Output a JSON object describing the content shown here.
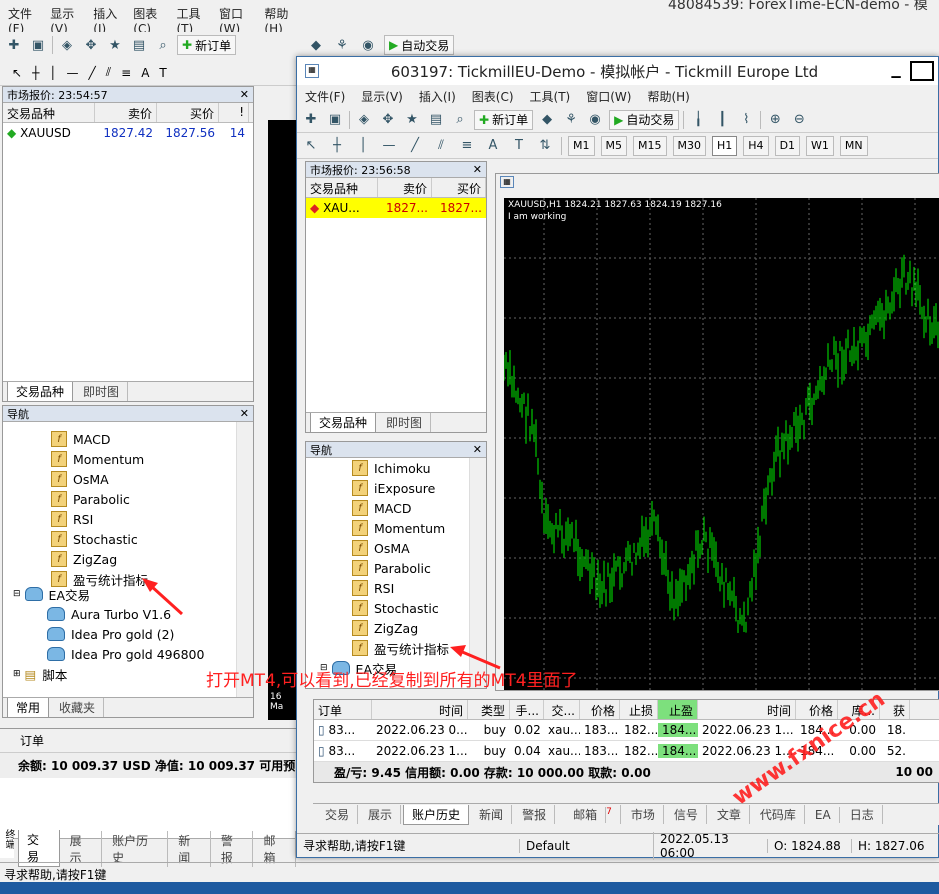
{
  "bg": {
    "title_fragment": "48084539: ForexTime-ECN-demo - 模",
    "menu": [
      "文件(F)",
      "显示(V)",
      "插入(I)",
      "图表(C)",
      "工具(T)",
      "窗口(W)",
      "帮助(H)"
    ],
    "new_order": "新订单",
    "auto_trade": "自动交易",
    "market_watch": {
      "title": "市场报价: 23:54:57",
      "headers": [
        "交易品种",
        "卖价",
        "买价",
        "!"
      ],
      "row": {
        "symbol": "XAUUSD",
        "bid": "1827.42",
        "ask": "1827.56",
        "spread": "14"
      },
      "tabs": [
        "交易品种",
        "即时图"
      ]
    },
    "navigator": {
      "title": "导航",
      "items": [
        "MACD",
        "Momentum",
        "OsMA",
        "Parabolic",
        "RSI",
        "Stochastic",
        "ZigZag",
        "盈亏统计指标"
      ],
      "ea_folder": "EA交易",
      "ea_items": [
        "Aura Turbo V1.6",
        "Idea Pro gold (2)",
        "Idea Pro gold 496800"
      ],
      "scripts": "脚本",
      "tabs": [
        "常用",
        "收藏夹"
      ]
    },
    "terminal": {
      "order_header": "订单",
      "balance": "余额: 10 009.37 USD  净值: 10 009.37  可用预",
      "side_label": "终端",
      "tabs": [
        "交易",
        "展示",
        "账户历史",
        "新闻",
        "警报",
        "邮箱"
      ]
    },
    "status": "寻求帮助,请按F1键",
    "chart_date": "16 Ma"
  },
  "fg": {
    "title": "603197: TickmillEU-Demo - 模拟帐户 - Tickmill Europe Ltd",
    "menu": [
      "文件(F)",
      "显示(V)",
      "插入(I)",
      "图表(C)",
      "工具(T)",
      "窗口(W)",
      "帮助(H)"
    ],
    "new_order": "新订单",
    "auto_trade": "自动交易",
    "timeframes": [
      "M1",
      "M5",
      "M15",
      "M30",
      "H1",
      "H4",
      "D1",
      "W1",
      "MN"
    ],
    "market_watch": {
      "title": "市场报价: 23:56:58",
      "headers": [
        "交易品种",
        "卖价",
        "买价"
      ],
      "row": {
        "symbol": "XAU...",
        "bid": "1827...",
        "ask": "1827..."
      },
      "tabs": [
        "交易品种",
        "即时图"
      ]
    },
    "navigator": {
      "title": "导航",
      "items": [
        "Ichimoku",
        "iExposure",
        "MACD",
        "Momentum",
        "OsMA",
        "Parabolic",
        "RSI",
        "Stochastic",
        "ZigZag",
        "盈亏统计指标"
      ],
      "ea_folder": "EA交易"
    },
    "chart": {
      "info": "XAUUSD,H1  1824.21 1827.63 1824.19 1827.16",
      "comment": "I am working"
    },
    "orders": {
      "headers": [
        "订单",
        "时间",
        "类型",
        "手...",
        "交...",
        "价格",
        "止损",
        "止盈",
        "时间",
        "价格",
        "库...",
        "获"
      ],
      "rows": [
        [
          "83...",
          "2022.06.23 0...",
          "buy",
          "0.02",
          "xau...",
          "183...",
          "182...",
          "184...",
          "2022.06.23 1...",
          "184...",
          "0.00",
          "18."
        ],
        [
          "83...",
          "2022.06.23 1...",
          "buy",
          "0.04",
          "xau...",
          "183...",
          "182...",
          "184...",
          "2022.06.23 1...",
          "184...",
          "0.00",
          "52."
        ]
      ],
      "summary": "盈/亏: 9.45  信用额: 0.00  存款: 10 000.00  取款: 0.00",
      "summary_right": "10 00"
    },
    "tabs": [
      "交易",
      "展示",
      "账户历史",
      "新闻",
      "警报",
      "邮箱",
      "市场",
      "信号",
      "文章",
      "代码库",
      "EA",
      "日志"
    ],
    "mail_count": "7",
    "status": {
      "help": "寻求帮助,请按F1键",
      "profile": "Default",
      "time": "2022.05.13 06:00",
      "open": "O: 1824.88",
      "high": "H: 1827.06"
    }
  },
  "annotation": "打开MT4,可以看到,已经复制到所有的MT4里面了",
  "watermark": "www.fxnice.cn",
  "colors": {
    "chart_bg": "#000000",
    "candle": "#00c800",
    "highlight": "#ffff00",
    "annotation": "#ff2020"
  }
}
